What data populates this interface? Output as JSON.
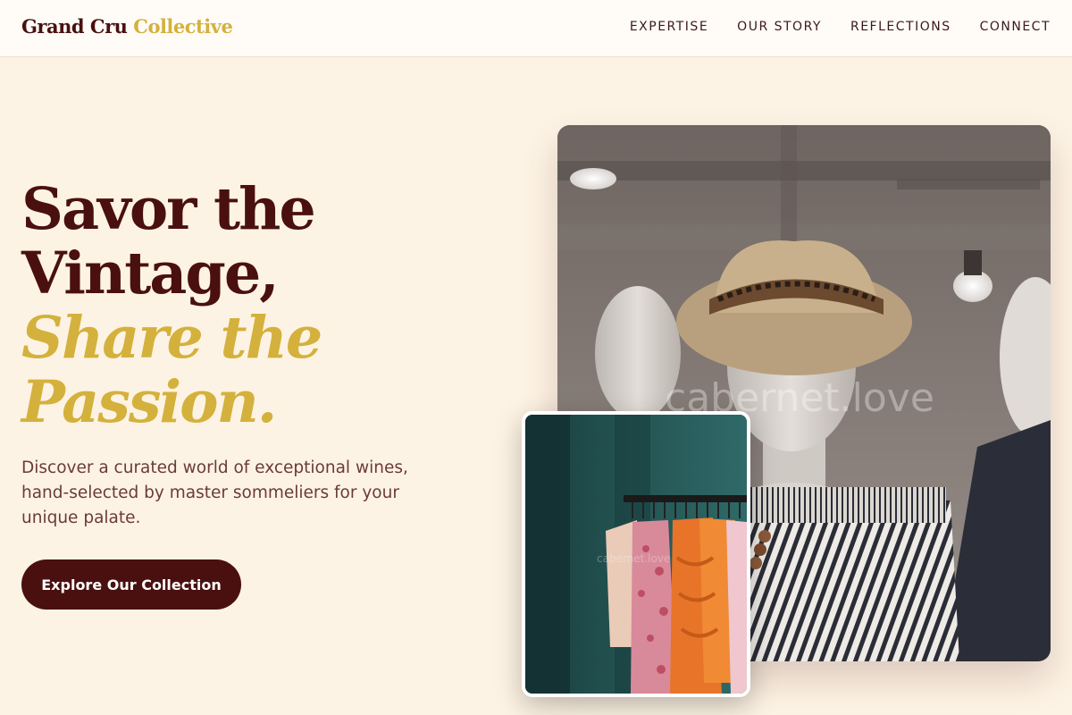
{
  "header": {
    "logo_main": "Grand Cru",
    "logo_accent": "Collective",
    "nav": [
      "EXPERTISE",
      "OUR STORY",
      "REFLECTIONS",
      "CONNECT"
    ]
  },
  "hero": {
    "line1": "Savor the",
    "line2": "Vintage,",
    "line3": "Share the",
    "line4": "Passion.",
    "description": "Discover a curated world of exceptional wines, hand-selected by master sommeliers for your unique palate.",
    "cta_label": "Explore Our Collection"
  },
  "images": {
    "main_watermark": "cabernet.love",
    "sub_watermark": "cabernet.love"
  },
  "colors": {
    "brand": "#4a1010",
    "accent_gold": "#d4b13c",
    "background": "#fdf3e4"
  }
}
